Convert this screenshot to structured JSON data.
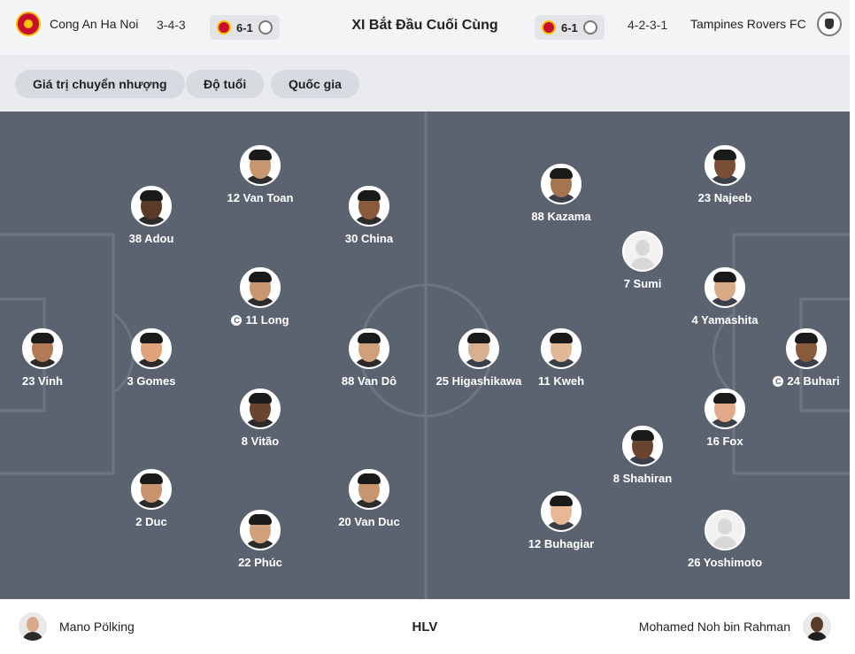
{
  "header": {
    "title": "XI Bắt Đầu Cuối Cùng",
    "home": {
      "name": "Cong An Ha Noi",
      "formation": "3-4-3",
      "badge_icon": "cahn-crest-icon"
    },
    "away": {
      "name": "Tampines Rovers FC",
      "formation": "4-2-3-1",
      "badge_icon": "tampines-crest-icon"
    },
    "score_home_pill": "6-1",
    "score_away_pill": "6-1"
  },
  "filters": [
    {
      "label": "Giá trị chuyển nhượng"
    },
    {
      "label": "Độ tuổi"
    },
    {
      "label": "Quốc gia"
    }
  ],
  "home_players": [
    {
      "name": "23 Vinh",
      "skin": "#b07a55",
      "shirt": "#c8102e"
    },
    {
      "name": "3 Gomes",
      "skin": "#e0a27a",
      "shirt": "#c8102e"
    },
    {
      "name": "38 Adou",
      "skin": "#5a3a28",
      "shirt": "#c8102e"
    },
    {
      "name": "2 Duc",
      "skin": "#c89470",
      "shirt": "#c8102e"
    },
    {
      "name": "12 Van Toan",
      "skin": "#c8966e",
      "shirt": "#c8102e"
    },
    {
      "name": "11 Long",
      "skin": "#c8966e",
      "shirt": "#c8102e",
      "captain": true
    },
    {
      "name": "8 Vitão",
      "skin": "#6b4430",
      "shirt": "#c8102e"
    },
    {
      "name": "22 Phúc",
      "skin": "#d0a07a",
      "shirt": "#c8102e"
    },
    {
      "name": "30 China",
      "skin": "#8a5a3c",
      "shirt": "#c8102e"
    },
    {
      "name": "88 Van Dô",
      "skin": "#d0a07a",
      "shirt": "#c8102e"
    },
    {
      "name": "20 Van Duc",
      "skin": "#c8966e",
      "shirt": "#c8102e"
    }
  ],
  "away_players": [
    {
      "name": "25 Higashikawa",
      "skin": "#d8b090",
      "shirt": "#ffffff"
    },
    {
      "name": "11 Kweh",
      "skin": "#e0b896",
      "shirt": "#ffffff"
    },
    {
      "name": "88 Kazama",
      "skin": "#a57550",
      "shirt": "#ffffff"
    },
    {
      "name": "12 Buhagiar",
      "skin": "#e8b894",
      "shirt": "#ffffff"
    },
    {
      "name": "7 Sumi",
      "placeholder": true
    },
    {
      "name": "8 Shahiran",
      "skin": "#6b4430",
      "shirt": "#ffffff"
    },
    {
      "name": "23 Najeeb",
      "skin": "#7a4e34",
      "shirt": "#ffffff"
    },
    {
      "name": "4 Yamashita",
      "skin": "#d8aa86",
      "shirt": "#ffffff"
    },
    {
      "name": "16 Fox",
      "skin": "#e0aa88",
      "shirt": "#ffffff"
    },
    {
      "name": "26 Yoshimoto",
      "placeholder": true
    },
    {
      "name": "24 Buhari",
      "skin": "#8a5a3c",
      "shirt": "#ffffff",
      "captain": true
    }
  ],
  "captain_mark": "C",
  "footer": {
    "label": "HLV",
    "home_coach": "Mano Pölking",
    "away_coach": "Mohamed Noh bin Rahman"
  }
}
